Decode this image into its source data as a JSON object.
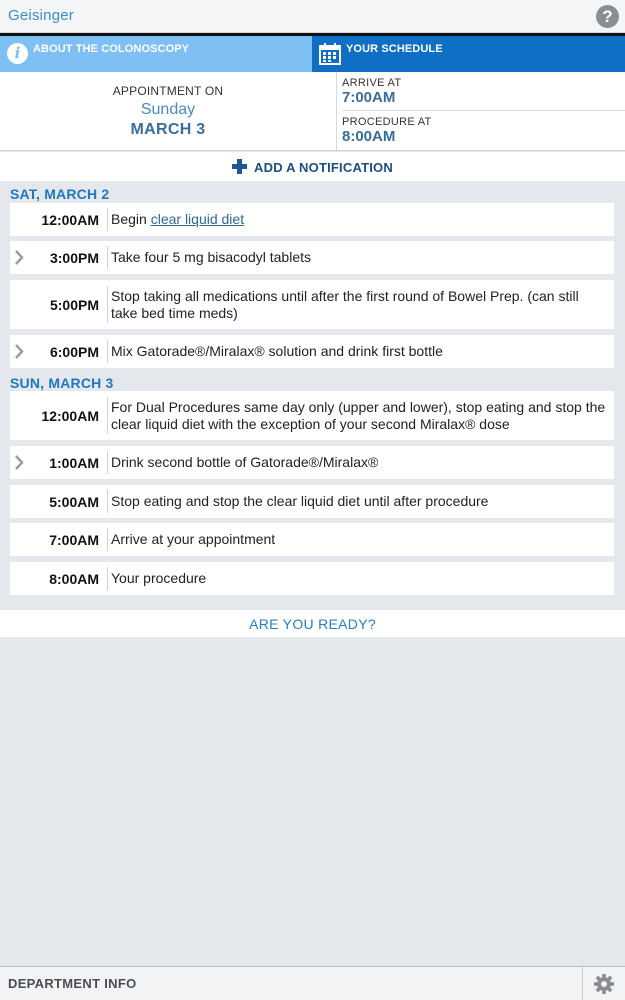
{
  "header": {
    "logo_text": "Geisinger",
    "help_icon": "help-icon"
  },
  "tabs": [
    {
      "label": "ABOUT THE COLONOSCOPY",
      "icon": "info-icon",
      "active": false
    },
    {
      "label": "YOUR SCHEDULE",
      "icon": "calendar-icon",
      "active": true
    }
  ],
  "appointment": {
    "caption": "APPOINTMENT ON",
    "day": "Sunday",
    "date": "MARCH 3",
    "arrive_label": "ARRIVE AT",
    "arrive_time": "7:00AM",
    "procedure_label": "PROCEDURE AT",
    "procedure_time": "8:00AM"
  },
  "add_notification": {
    "label": "ADD A NOTIFICATION",
    "icon": "plus-icon"
  },
  "schedule": [
    {
      "heading": "SAT, MARCH 2",
      "items": [
        {
          "time": "12:00AM",
          "text": "Begin ",
          "link": "clear liquid diet",
          "expandable": false
        },
        {
          "time": "3:00PM",
          "text": "Take four 5 mg bisacodyl tablets",
          "expandable": true
        },
        {
          "time": "5:00PM",
          "text": "Stop taking all medications until after the first round of Bowel Prep. (can still take bed time meds)",
          "expandable": false
        },
        {
          "time": "6:00PM",
          "text": "Mix Gatorade®/Miralax® solution and drink first bottle",
          "expandable": true
        }
      ]
    },
    {
      "heading": "SUN, MARCH 3",
      "items": [
        {
          "time": "12:00AM",
          "text": "For Dual Procedures same day only (upper and lower), stop eating and stop the clear liquid diet with the exception of your second Miralax® dose",
          "expandable": false
        },
        {
          "time": "1:00AM",
          "text": "Drink second bottle of Gatorade®/Miralax®",
          "expandable": true
        },
        {
          "time": "5:00AM",
          "text": "Stop eating and stop the clear liquid diet until after procedure",
          "expandable": false
        },
        {
          "time": "7:00AM",
          "text": "Arrive at your appointment",
          "expandable": false
        },
        {
          "time": "8:00AM",
          "text": "Your procedure",
          "expandable": false
        }
      ]
    }
  ],
  "ready": {
    "label": "ARE YOU READY?"
  },
  "footer": {
    "department_label": "DEPARTMENT INFO",
    "settings_icon": "gear-icon"
  },
  "colors": {
    "tab_inactive": "#7ec0f3",
    "tab_active": "#0f6fc4",
    "accent_dark": "#386d9c",
    "heading_blue": "#1f77c0"
  }
}
